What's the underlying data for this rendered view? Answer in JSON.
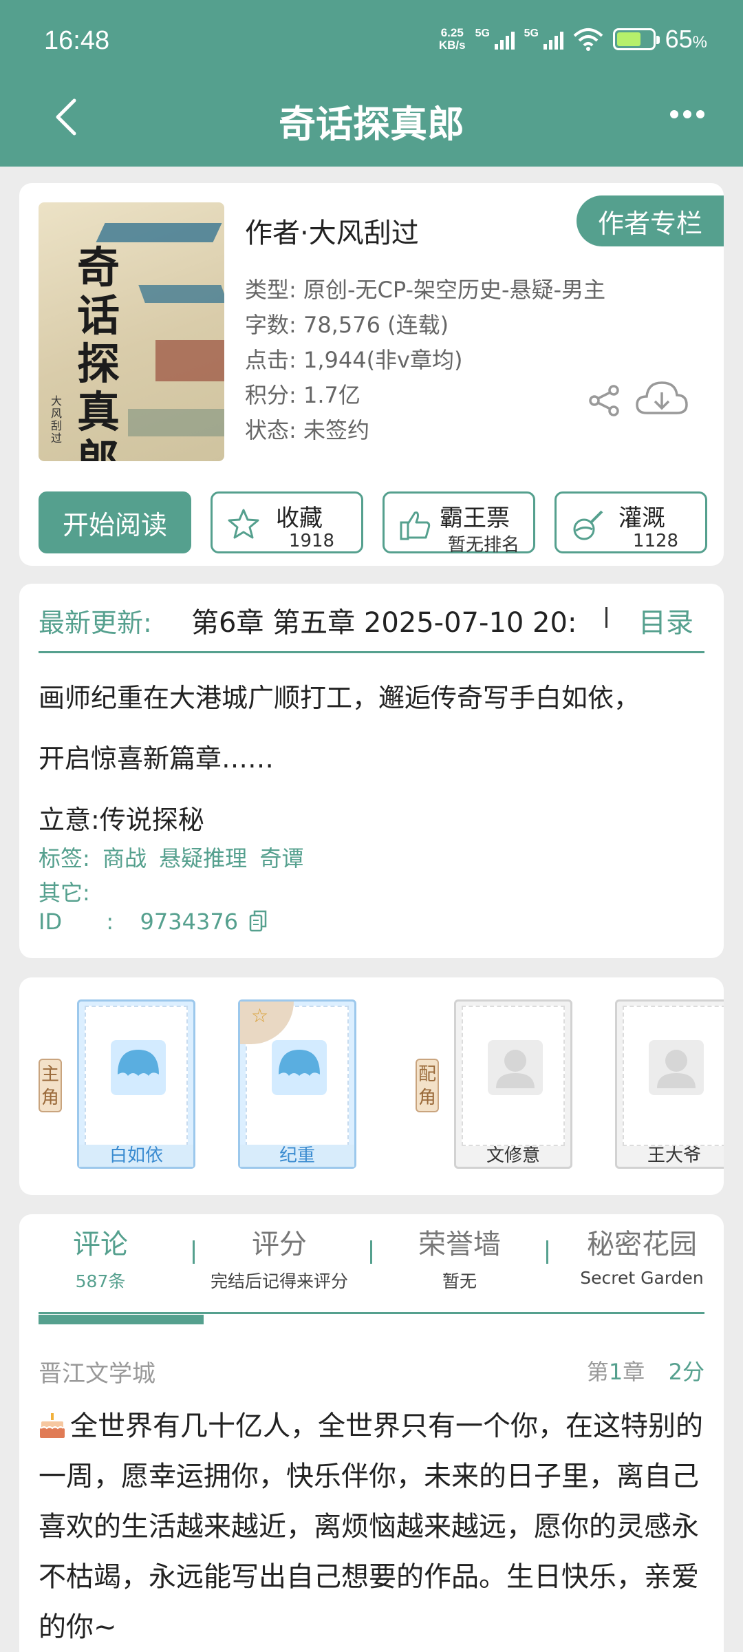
{
  "status": {
    "time": "16:48",
    "net_speed_value": "6.25",
    "net_speed_unit": "KB/s",
    "signal1": "5G",
    "signal2": "5G",
    "battery": "65",
    "battery_unit": "%",
    "battery_level": 0.65
  },
  "header": {
    "title": "奇话探真郎"
  },
  "book": {
    "cover_title": "奇话探真郎",
    "cover_author": "大风刮过",
    "author_column_label": "作者专栏",
    "author_line": "作者·大风刮过",
    "meta": [
      "类型: 原创-无CP-架空历史-悬疑-男主",
      "字数: 78,576 (连载)",
      "点击: 1,944(非v章均)",
      "积分: 1.7亿",
      "状态: 未签约"
    ],
    "actions": {
      "read": "开始阅读",
      "favorite_label": "收藏",
      "favorite_count": "1918",
      "ticket_label": "霸王票",
      "ticket_sub": "暂无排名",
      "water_label": "灌溉",
      "water_count": "1128"
    }
  },
  "info": {
    "update_label": "最新更新:",
    "update_text": "第6章  第五章  2025-07-10 20:",
    "toc_label": "目录",
    "summary_lines": [
      "画师纪重在大港城广顺打工，邂逅传奇写手白如依，",
      "开启惊喜新篇章……"
    ],
    "theme": "立意:传说探秘",
    "tags_label": "标签:",
    "tags": [
      "商战",
      "悬疑推理",
      "奇谭"
    ],
    "others_label": "其它:",
    "id_label": "ID",
    "id_colon": ":",
    "id_value": "9734376"
  },
  "characters": {
    "main_tag": "主角",
    "support_tag": "配角",
    "main": [
      "白如依",
      "纪重"
    ],
    "support": [
      "文修意",
      "王大爷"
    ]
  },
  "comments": {
    "tabs": [
      {
        "title": "评论",
        "sub": "587条"
      },
      {
        "title": "评分",
        "sub": "完结后记得来评分"
      },
      {
        "title": "荣誉墙",
        "sub": "暂无"
      },
      {
        "title": "秘密花园",
        "sub": "Secret Garden"
      }
    ],
    "item": {
      "site": "晋江文学城",
      "chapter_prefix": "第",
      "chapter_num": "1",
      "chapter_suffix": "章",
      "score_num": "2",
      "score_unit": "分",
      "body": "全世界有几十亿人，全世界只有一个你，在这特别的一周，愿幸运拥你，快乐伴你，未来的日子里，离自己喜欢的生活越来越近，离烦恼越来越远，愿你的灵感永不枯竭，永远能写出自己想要的作品。生日快乐，亲爱的你~"
    }
  },
  "colors": {
    "accent": "#55a08e",
    "main_role": "#3a8bd0"
  }
}
